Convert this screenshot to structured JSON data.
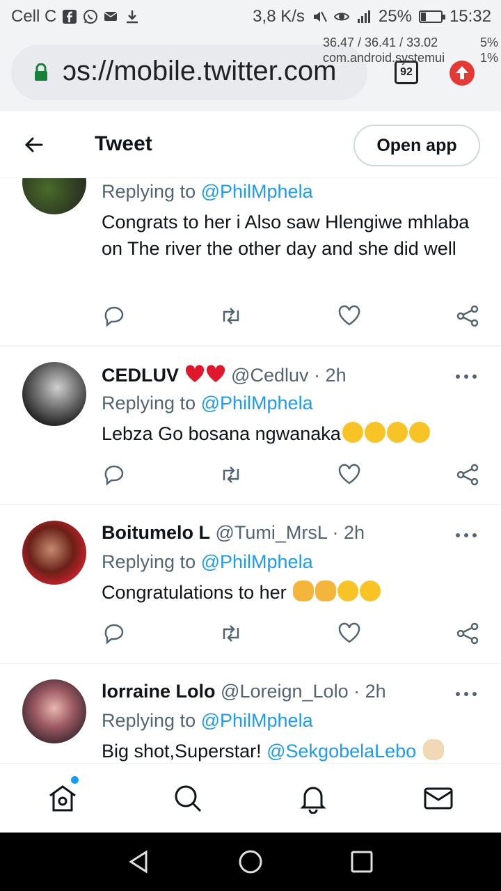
{
  "status_bar": {
    "carrier": "Cell C",
    "left_icons": [
      "facebook-icon",
      "whatsapp-icon",
      "message-icon",
      "download-icon"
    ],
    "speed": "3,8 K/s",
    "right_icons": [
      "mute-icon",
      "eye-icon",
      "signal-icon"
    ],
    "battery_percent": "25%",
    "battery_level": 0.25,
    "time": "15:32"
  },
  "browser": {
    "url": "ɔs://mobile.twitter.com",
    "tab_count": "92",
    "overlay_stats": {
      "line1_left": "36.47 / 36.41 / 33.02",
      "line1_right": "5%",
      "line2_left": "com.android.systemui",
      "line2_right": "1%"
    }
  },
  "header": {
    "title": "Tweet",
    "open_app_label": "Open app"
  },
  "tweets": [
    {
      "name": "",
      "handle": "",
      "time": "",
      "replying_prefix": "Replying to ",
      "replying_to": "@PhilMphela",
      "text": "Congrats to her i Also saw Hlengiwe mhlaba on The river the other day and she did well"
    },
    {
      "name": "CEDLUV",
      "name_emojis": [
        "heart-emoji",
        "heart-emoji"
      ],
      "handle": "@Cedluv",
      "dot": "·",
      "time": "2h",
      "replying_prefix": "Replying to ",
      "replying_to": "@PhilMphela",
      "text": "Lebza Go bosana ngwanaka",
      "text_emojis": [
        "grinning-emoji",
        "grinning-emoji",
        "grinning-emoji",
        "grinning-emoji"
      ]
    },
    {
      "name": "Boitumelo L",
      "handle": "@Tumi_MrsL",
      "dot": "·",
      "time": "2h",
      "replying_prefix": "Replying to ",
      "replying_to": "@PhilMphela",
      "text": "Congratulations to her ",
      "text_emojis": [
        "clapping-emoji",
        "clapping-emoji",
        "party-face-emoji",
        "party-face-emoji"
      ]
    },
    {
      "name": "lorraine Lolo",
      "handle": "@Loreign_Lolo",
      "dot": "·",
      "time": "2h",
      "replying_prefix": "Replying to ",
      "replying_to": "@PhilMphela",
      "text": "Big shot,Superstar! ",
      "text_mention": "@SekgobelaLebo",
      "text_emojis": [
        "raising-hands-emoji"
      ]
    }
  ],
  "bottom_nav": [
    "home-icon",
    "search-icon",
    "notifications-icon",
    "messages-icon"
  ],
  "system_nav": [
    "back-icon",
    "home-circle-icon",
    "recents-icon"
  ],
  "colors": {
    "accent": "#1d9bf0",
    "text": "#0f1419",
    "secondary": "#536471",
    "chrome": "#f1f3f4"
  }
}
